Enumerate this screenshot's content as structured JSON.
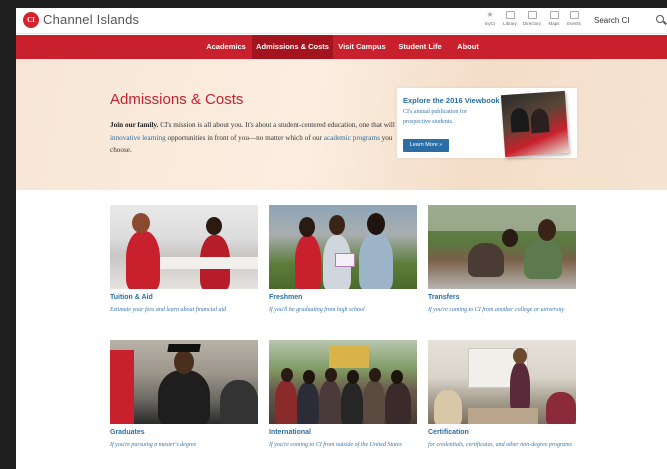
{
  "header": {
    "logo_text": "CI",
    "site_name": "Channel Islands",
    "utilities": [
      {
        "icon": "star-icon",
        "label": "myCI"
      },
      {
        "icon": "library-icon",
        "label": "Library"
      },
      {
        "icon": "directory-icon",
        "label": "Directory"
      },
      {
        "icon": "maps-icon",
        "label": "Maps"
      },
      {
        "icon": "events-icon",
        "label": "Events"
      }
    ],
    "search_label": "Search CI"
  },
  "nav": {
    "items": [
      "Academics",
      "Admissions & Costs",
      "Visit Campus",
      "Student Life",
      "About"
    ],
    "active": "Admissions & Costs"
  },
  "hero": {
    "title": "Admissions & Costs",
    "lead_bold": "Join our family.",
    "lead_1": " CI's mission is all about you. It's about a student-centered education, one that will put ",
    "lead_link_1": "innovative learning",
    "lead_2": " opportunities in front of you—no matter which of our ",
    "lead_link_2": "academic programs",
    "lead_3": " you choose."
  },
  "promo": {
    "title": "Explore the 2016 Viewbook",
    "desc": "CI's annual publication for prospective students.",
    "button": "Learn More »"
  },
  "cards": [
    {
      "title": "Tuition & Aid",
      "desc": "Estimate your fees and learn about financial aid"
    },
    {
      "title": "Freshmen",
      "desc": "If you'll be graduating from high school"
    },
    {
      "title": "Transfers",
      "desc": "If you're coming to CI from another college or university"
    },
    {
      "title": "Graduates",
      "desc": "If you're pursuing a master's degree"
    },
    {
      "title": "International",
      "desc": "If you're coming to CI from outside of the United States"
    },
    {
      "title": "Certification",
      "desc": "for credentials, certificates, and other non-degree programs"
    }
  ],
  "colors": {
    "brand_red": "#c8202c",
    "link_blue": "#2a6fa6",
    "hero_bg": "#f7e6d6"
  }
}
